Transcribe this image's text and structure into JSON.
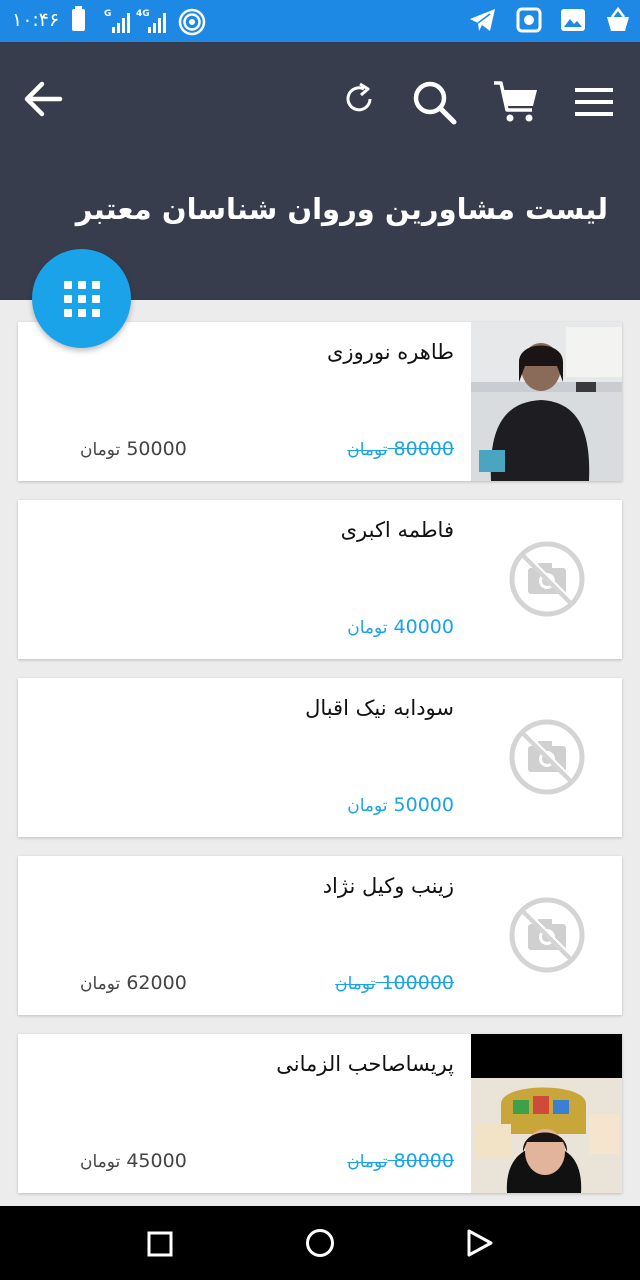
{
  "status_bar": {
    "time": "۱۰:۴۶",
    "signal_1_label": "G",
    "signal_2_label": "4G",
    "icons": [
      "telegram-icon",
      "camera-app-icon",
      "gallery-icon",
      "shopping-basket-icon"
    ]
  },
  "app_bar": {
    "title": "لیست مشاورین وروان شناسان معتبر",
    "icons": [
      "back-arrow-icon",
      "refresh-icon",
      "search-icon",
      "cart-icon",
      "menu-icon"
    ]
  },
  "fab": {
    "icon": "grid-icon"
  },
  "consultants": [
    {
      "name": "طاهره نوروزی",
      "old_price": "80000",
      "price": "50000",
      "currency": "تومان",
      "photo": "photo"
    },
    {
      "name": "فاطمه اکبری",
      "old_price": "",
      "price": "40000",
      "currency": "تومان",
      "photo": "none"
    },
    {
      "name": "سودابه نیک اقبال",
      "old_price": "",
      "price": "50000",
      "currency": "تومان",
      "photo": "none"
    },
    {
      "name": "زینب وکیل نژاد",
      "old_price": "100000",
      "price": "62000",
      "currency": "تومان",
      "photo": "none"
    },
    {
      "name": "پریساصاحب الزمانی",
      "old_price": "80000",
      "price": "45000",
      "currency": "تومان",
      "photo": "photo"
    }
  ],
  "colors": {
    "status_bar": "#1e88e5",
    "app_bar": "#383d4d",
    "accent": "#1aa3e8",
    "background": "#ececec"
  },
  "nav_bar": {
    "icons": [
      "recents-square-icon",
      "home-circle-icon",
      "back-triangle-icon"
    ]
  }
}
